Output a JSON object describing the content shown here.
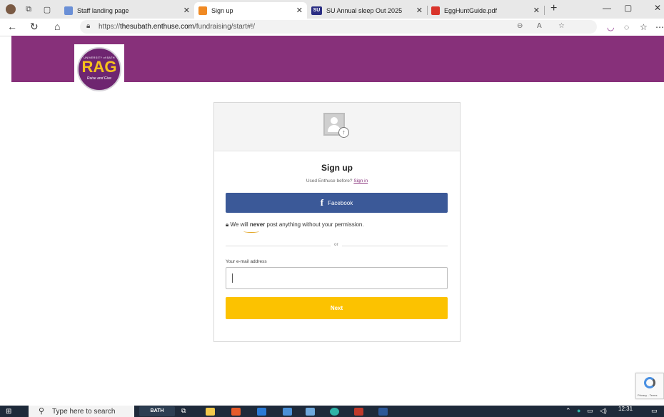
{
  "browser": {
    "tabs": [
      {
        "label": "Staff landing page",
        "favicon_color": "#6a8fd6"
      },
      {
        "label": "Sign up",
        "favicon_color": "#f08a24",
        "active": true
      },
      {
        "label": "SU Annual sleep Out 2025",
        "favicon_color": "#2b2e83",
        "favicon_text": "SU"
      },
      {
        "label": "EggHuntGuide.pdf",
        "favicon_color": "#d9342b"
      }
    ],
    "new_tab": "+",
    "url_prefix": "https://",
    "url_host": "thesubath.enthuse.com",
    "url_path": "/fundraising/start#!/"
  },
  "site": {
    "header_color": "#87307a",
    "logo": {
      "top_text": "UNIVERSITY of BATH",
      "main": "RAG",
      "script": "Raise and Give"
    }
  },
  "signup": {
    "title": "Sign up",
    "subtitle_prefix": "Used Enthuse before?",
    "sign_in_link": "Sign in",
    "facebook_button": "Facebook",
    "notice_prefix": "We will",
    "notice_emph": "never",
    "notice_suffix": "post anything without your permission.",
    "divider": "or",
    "email_label": "Your e-mail address",
    "email_value": "",
    "next_button": "Next",
    "colors": {
      "facebook": "#3b5998",
      "next": "#fcc200"
    }
  },
  "recaptcha": {
    "text": "Privacy - Terms"
  },
  "taskbar": {
    "search_placeholder": "Type here to search",
    "bath_app": "BATH",
    "time": "12:31"
  }
}
